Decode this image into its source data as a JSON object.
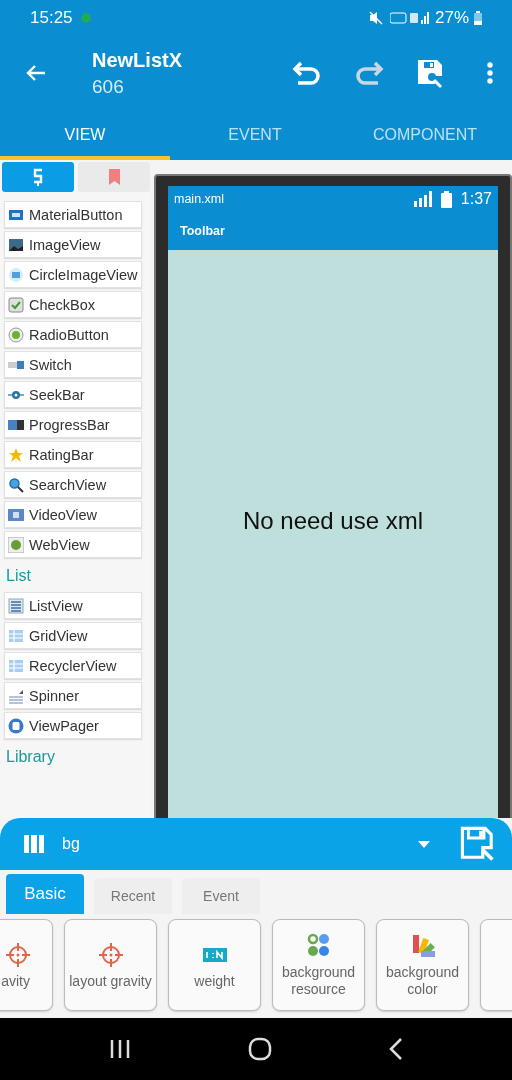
{
  "status_bar": {
    "time": "15:25",
    "battery": "27%"
  },
  "app_bar": {
    "title": "NewListX",
    "subtitle": "606"
  },
  "tabs": [
    {
      "label": "VIEW",
      "selected": true
    },
    {
      "label": "EVENT",
      "selected": false
    },
    {
      "label": "COMPONENT",
      "selected": false
    }
  ],
  "palette": {
    "tabs": [
      {
        "selected": true
      },
      {
        "selected": false
      }
    ],
    "entries": [
      {
        "kind": "widget",
        "label": "MaterialButton"
      },
      {
        "kind": "widget",
        "label": "ImageView"
      },
      {
        "kind": "widget",
        "label": "CircleImageView"
      },
      {
        "kind": "widget",
        "label": "CheckBox"
      },
      {
        "kind": "widget",
        "label": "RadioButton"
      },
      {
        "kind": "widget",
        "label": "Switch"
      },
      {
        "kind": "widget",
        "label": "SeekBar"
      },
      {
        "kind": "widget",
        "label": "ProgressBar"
      },
      {
        "kind": "widget",
        "label": "RatingBar"
      },
      {
        "kind": "widget",
        "label": "SearchView"
      },
      {
        "kind": "widget",
        "label": "VideoView"
      },
      {
        "kind": "widget",
        "label": "WebView"
      },
      {
        "kind": "heading",
        "label": "List"
      },
      {
        "kind": "widget",
        "label": "ListView"
      },
      {
        "kind": "widget",
        "label": "GridView"
      },
      {
        "kind": "widget",
        "label": "RecyclerView"
      },
      {
        "kind": "widget",
        "label": "Spinner"
      },
      {
        "kind": "widget",
        "label": "ViewPager"
      },
      {
        "kind": "heading",
        "label": "Library"
      }
    ]
  },
  "preview": {
    "file": "main.xml",
    "clock": "1:37",
    "toolbar": "Toolbar",
    "message": "No need use xml"
  },
  "property_sheet": {
    "view_id": "bg",
    "tabs": [
      {
        "label": "Basic",
        "selected": true
      },
      {
        "label": "Recent",
        "selected": false
      },
      {
        "label": "Event",
        "selected": false
      }
    ],
    "properties": [
      {
        "label": "avity"
      },
      {
        "label": "layout gravity"
      },
      {
        "label": "weight"
      },
      {
        "label": "background resource"
      },
      {
        "label": "background color"
      }
    ]
  }
}
